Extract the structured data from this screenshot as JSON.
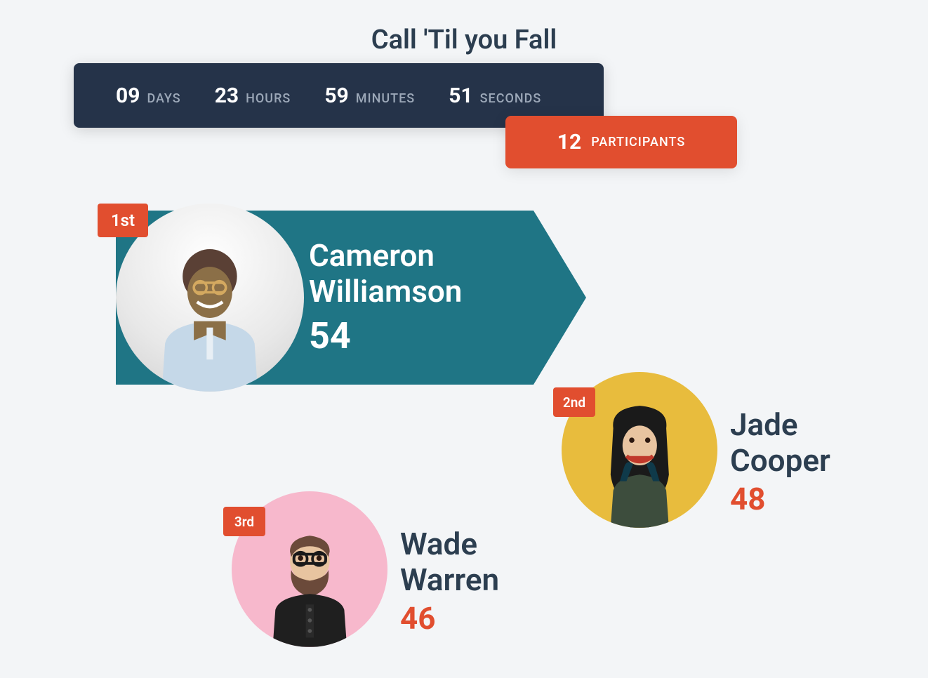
{
  "title": "Call 'Til you Fall",
  "countdown": {
    "days": {
      "value": "09",
      "label": "DAYS"
    },
    "hours": {
      "value": "23",
      "label": "HOURS"
    },
    "minutes": {
      "value": "59",
      "label": "MINUTES"
    },
    "seconds": {
      "value": "51",
      "label": "SECONDS"
    }
  },
  "participants": {
    "value": "12",
    "label": "PARTICIPANTS"
  },
  "leaderboard": {
    "first": {
      "rank": "1st",
      "name": "Cameron Williamson",
      "score": "54"
    },
    "second": {
      "rank": "2nd",
      "name": "Jade Cooper",
      "score": "48"
    },
    "third": {
      "rank": "3rd",
      "name": "Wade Warren",
      "score": "46"
    }
  }
}
